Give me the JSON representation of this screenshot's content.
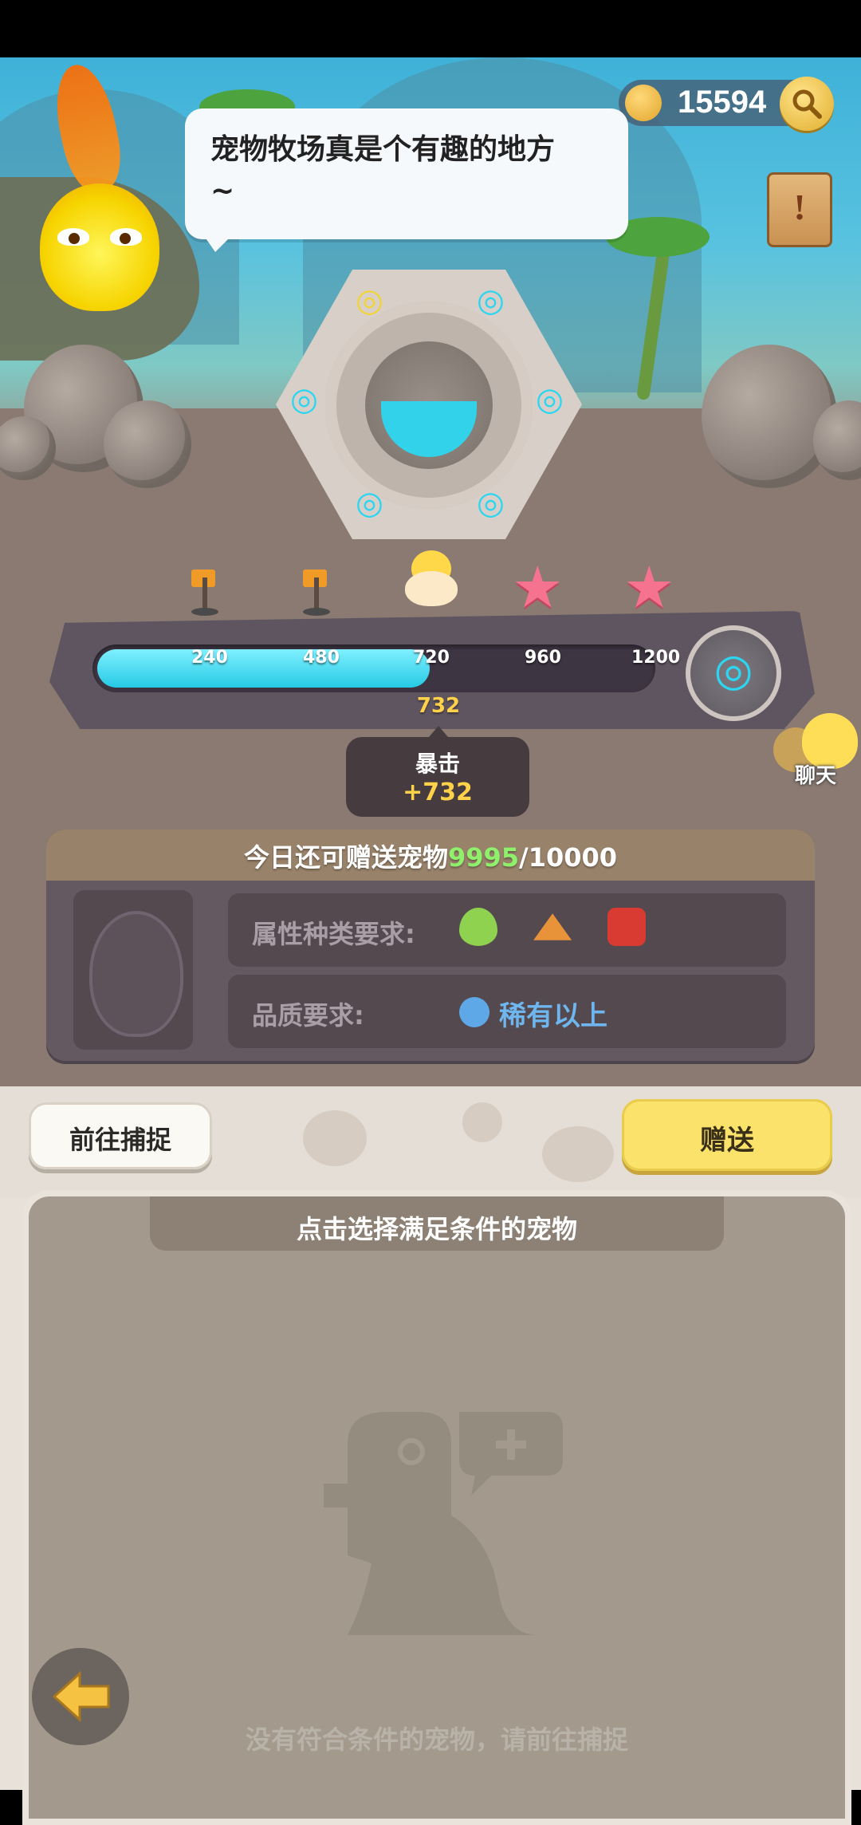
{
  "hud": {
    "coin_value": "15594"
  },
  "npc": {
    "speech": "宠物牧场真是个有趣的地方\n~"
  },
  "scroll_icon": "!",
  "progress": {
    "ticks": [
      "240",
      "480",
      "720",
      "960",
      "1200"
    ],
    "current_value": "732",
    "current": 732,
    "max": 1200,
    "crit_title": "暴击",
    "crit_value": "+732"
  },
  "chat": {
    "label": "聊天"
  },
  "requirements": {
    "header_prefix": "今日还可赠送宠物",
    "remaining": "9995",
    "header_total": "/10000",
    "type_label": "属性种类要求:",
    "quality_label": "品质要求:",
    "quality_value": "稀有以上",
    "type_icons": [
      "heart-green-icon",
      "mountain-icon",
      "fire-red-icon"
    ]
  },
  "actions": {
    "capture_label": "前往捕捉",
    "gift_label": "赠送"
  },
  "pet_list": {
    "header": "点击选择满足条件的宠物",
    "empty_text": "没有符合条件的宠物，请前往捕捉"
  },
  "colors": {
    "progress_fill": "#26c9e4",
    "gift_button": "#fbe26a",
    "remaining_count": "#8ff16b",
    "crit_value": "#ffd24a"
  }
}
